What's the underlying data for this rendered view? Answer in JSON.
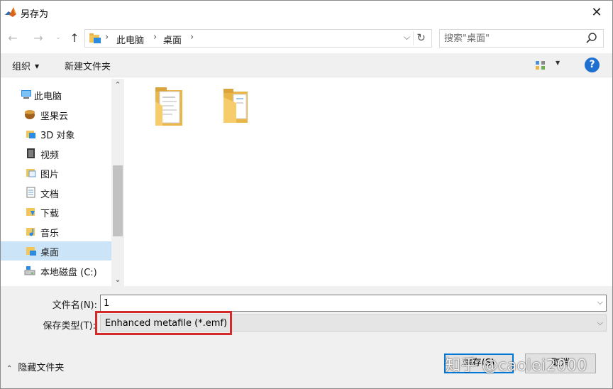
{
  "window": {
    "title": "另存为",
    "close_label": "✕"
  },
  "address": {
    "crumbs": [
      "此电脑",
      "桌面"
    ],
    "search_placeholder": "搜索\"桌面\""
  },
  "toolbar": {
    "organize_label": "组织",
    "new_folder_label": "新建文件夹",
    "help_label": "?"
  },
  "nav": {
    "items": [
      {
        "label": "此电脑",
        "icon": "computer-icon",
        "selected": false
      },
      {
        "label": "坚果云",
        "icon": "nutstore-icon",
        "selected": false
      },
      {
        "label": "3D 对象",
        "icon": "3d-objects-icon",
        "selected": false
      },
      {
        "label": "视频",
        "icon": "video-icon",
        "selected": false
      },
      {
        "label": "图片",
        "icon": "pictures-icon",
        "selected": false
      },
      {
        "label": "文档",
        "icon": "documents-icon",
        "selected": false
      },
      {
        "label": "下载",
        "icon": "downloads-icon",
        "selected": false
      },
      {
        "label": "音乐",
        "icon": "music-icon",
        "selected": false
      },
      {
        "label": "桌面",
        "icon": "desktop-icon",
        "selected": true
      },
      {
        "label": "本地磁盘 (C:)",
        "icon": "drive-icon",
        "selected": false
      }
    ]
  },
  "content": {
    "files": [
      {
        "name": "",
        "icon": "folder-with-documents-icon"
      },
      {
        "name": "",
        "icon": "folder-icon"
      }
    ]
  },
  "form": {
    "filename_label": "文件名(N):",
    "filename_value": "1",
    "filetype_label": "保存类型(T):",
    "filetype_value": "Enhanced metafile (*.emf)"
  },
  "footer": {
    "hide_folders_label": "隐藏文件夹",
    "save_label": "保存(S)",
    "cancel_label": "取消"
  },
  "watermark": {
    "text": "知乎 @caolei2000"
  },
  "colors": {
    "accent": "#0078d7",
    "selection": "#cce4f7",
    "highlight_border": "#d42a2a",
    "help_icon": "#1e6fd0"
  }
}
